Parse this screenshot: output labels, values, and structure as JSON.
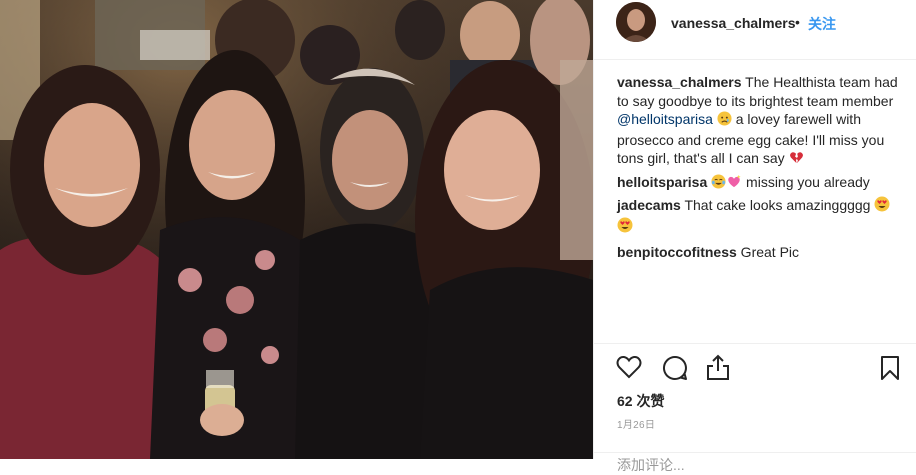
{
  "post": {
    "username": "vanessa_chalmers",
    "separator": "•",
    "follow_label": "关注"
  },
  "comments": [
    {
      "user": "vanessa_chalmers",
      "text_before": " The Healthista team had to say goodbye to its brightest team member ",
      "mention": "@helloitsparisa",
      "text_after": " a lovey farewell with prosecco and creme egg cake! I'll miss you tons girl, that's all I can say ",
      "emojis": [
        "sad-face",
        "broken-heart"
      ]
    },
    {
      "user": "helloitsparisa",
      "text": " missing you already",
      "emojis": [
        "tears-of-joy",
        "sparkling-heart"
      ]
    },
    {
      "user": "jadecams",
      "text": " That cake looks amazinggggg ",
      "emojis": [
        "heart-eyes",
        "heart-eyes"
      ]
    },
    {
      "user": "benpitoccofitness",
      "text": " Great Pic",
      "emojis": []
    }
  ],
  "actions": {
    "likes": "62 次赞",
    "date": "1月26日",
    "add_comment_placeholder": "添加评论..."
  },
  "icons": [
    "heart-icon",
    "comment-icon",
    "share-icon",
    "bookmark-icon"
  ],
  "colors": {
    "link": "#3897f0",
    "mention": "#003569",
    "muted": "#999999",
    "text": "#262626"
  }
}
